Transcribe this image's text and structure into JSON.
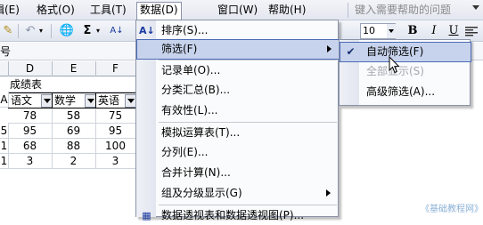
{
  "menubar": {
    "items": [
      {
        "label": "编辑(E)"
      },
      {
        "label": "格式(O)"
      },
      {
        "label": "工具(T)"
      },
      {
        "label": "数据(D)"
      },
      {
        "label": "窗口(W)"
      },
      {
        "label": "帮助(H)"
      }
    ],
    "help_placeholder": "键入需要帮助的问题"
  },
  "toolbar": {
    "font_size": "10",
    "sort_icon_text": "A↓",
    "sigma": "Σ",
    "bold": "B",
    "italic": "I",
    "underline": "U"
  },
  "formula_bar": {
    "name_box_fragment": "号"
  },
  "sheet": {
    "columns": [
      "D",
      "E",
      "F"
    ],
    "title_cell": "成绩表",
    "headers": [
      "语文",
      "数学",
      "英语"
    ],
    "rows": [
      [
        "78",
        "58",
        "75"
      ],
      [
        "95",
        "69",
        "95"
      ],
      [
        "68",
        "88",
        "100"
      ],
      [
        "3",
        "2",
        "3"
      ]
    ],
    "left_fragments": [
      "A",
      "5",
      "1",
      "1"
    ]
  },
  "data_menu": {
    "items": [
      {
        "label": "排序(S)...",
        "icon": "sort-az-icon"
      },
      {
        "label": "筛选(F)",
        "submenu": true
      },
      {
        "label": "记录单(O)..."
      },
      {
        "label": "分类汇总(B)..."
      },
      {
        "label": "有效性(L)..."
      },
      {
        "label": "模拟运算表(T)..."
      },
      {
        "label": "分列(E)..."
      },
      {
        "label": "合并计算(N)..."
      },
      {
        "label": "组及分级显示(G)",
        "submenu": true
      },
      {
        "label": "数据透视表和数据透视图(P)..."
      }
    ]
  },
  "filter_submenu": {
    "items": [
      {
        "label": "自动筛选(F)",
        "checked": true
      },
      {
        "label": "全部显示(S)",
        "disabled": true
      },
      {
        "label": "高级筛选(A)..."
      }
    ]
  },
  "watermark": "《基础教程网》",
  "colors": {
    "highlight": "#c7d3ec",
    "highlight_border": "#4b6bb5"
  }
}
